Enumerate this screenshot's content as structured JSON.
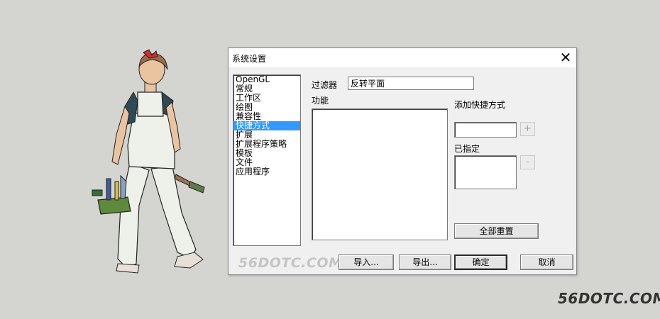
{
  "window": {
    "title": "系统设置",
    "close_symbol": "✕"
  },
  "sidebar": {
    "items": [
      {
        "label": "OpenGL",
        "selected": false
      },
      {
        "label": "常规",
        "selected": false
      },
      {
        "label": "工作区",
        "selected": false
      },
      {
        "label": "绘图",
        "selected": false
      },
      {
        "label": "兼容性",
        "selected": false
      },
      {
        "label": "快捷方式",
        "selected": true
      },
      {
        "label": "扩展",
        "selected": false
      },
      {
        "label": "扩展程序策略",
        "selected": false
      },
      {
        "label": "模板",
        "selected": false
      },
      {
        "label": "文件",
        "selected": false
      },
      {
        "label": "应用程序",
        "selected": false
      }
    ]
  },
  "filter": {
    "label": "过滤器",
    "value": "反转平面"
  },
  "function": {
    "label": "功能"
  },
  "add_shortcut": {
    "label": "添加快捷方式",
    "value": "",
    "add_symbol": "+"
  },
  "assigned": {
    "label": "已指定",
    "remove_symbol": "-"
  },
  "buttons": {
    "reset_all": "全部重置",
    "import": "导入...",
    "export": "导出...",
    "ok": "确定",
    "cancel": "取消"
  },
  "watermarks": {
    "dialog": "56DOTC.COM",
    "page": "56DOTC.COM"
  },
  "colors": {
    "selection": "#3399ff",
    "background": "#d4d4d0"
  }
}
